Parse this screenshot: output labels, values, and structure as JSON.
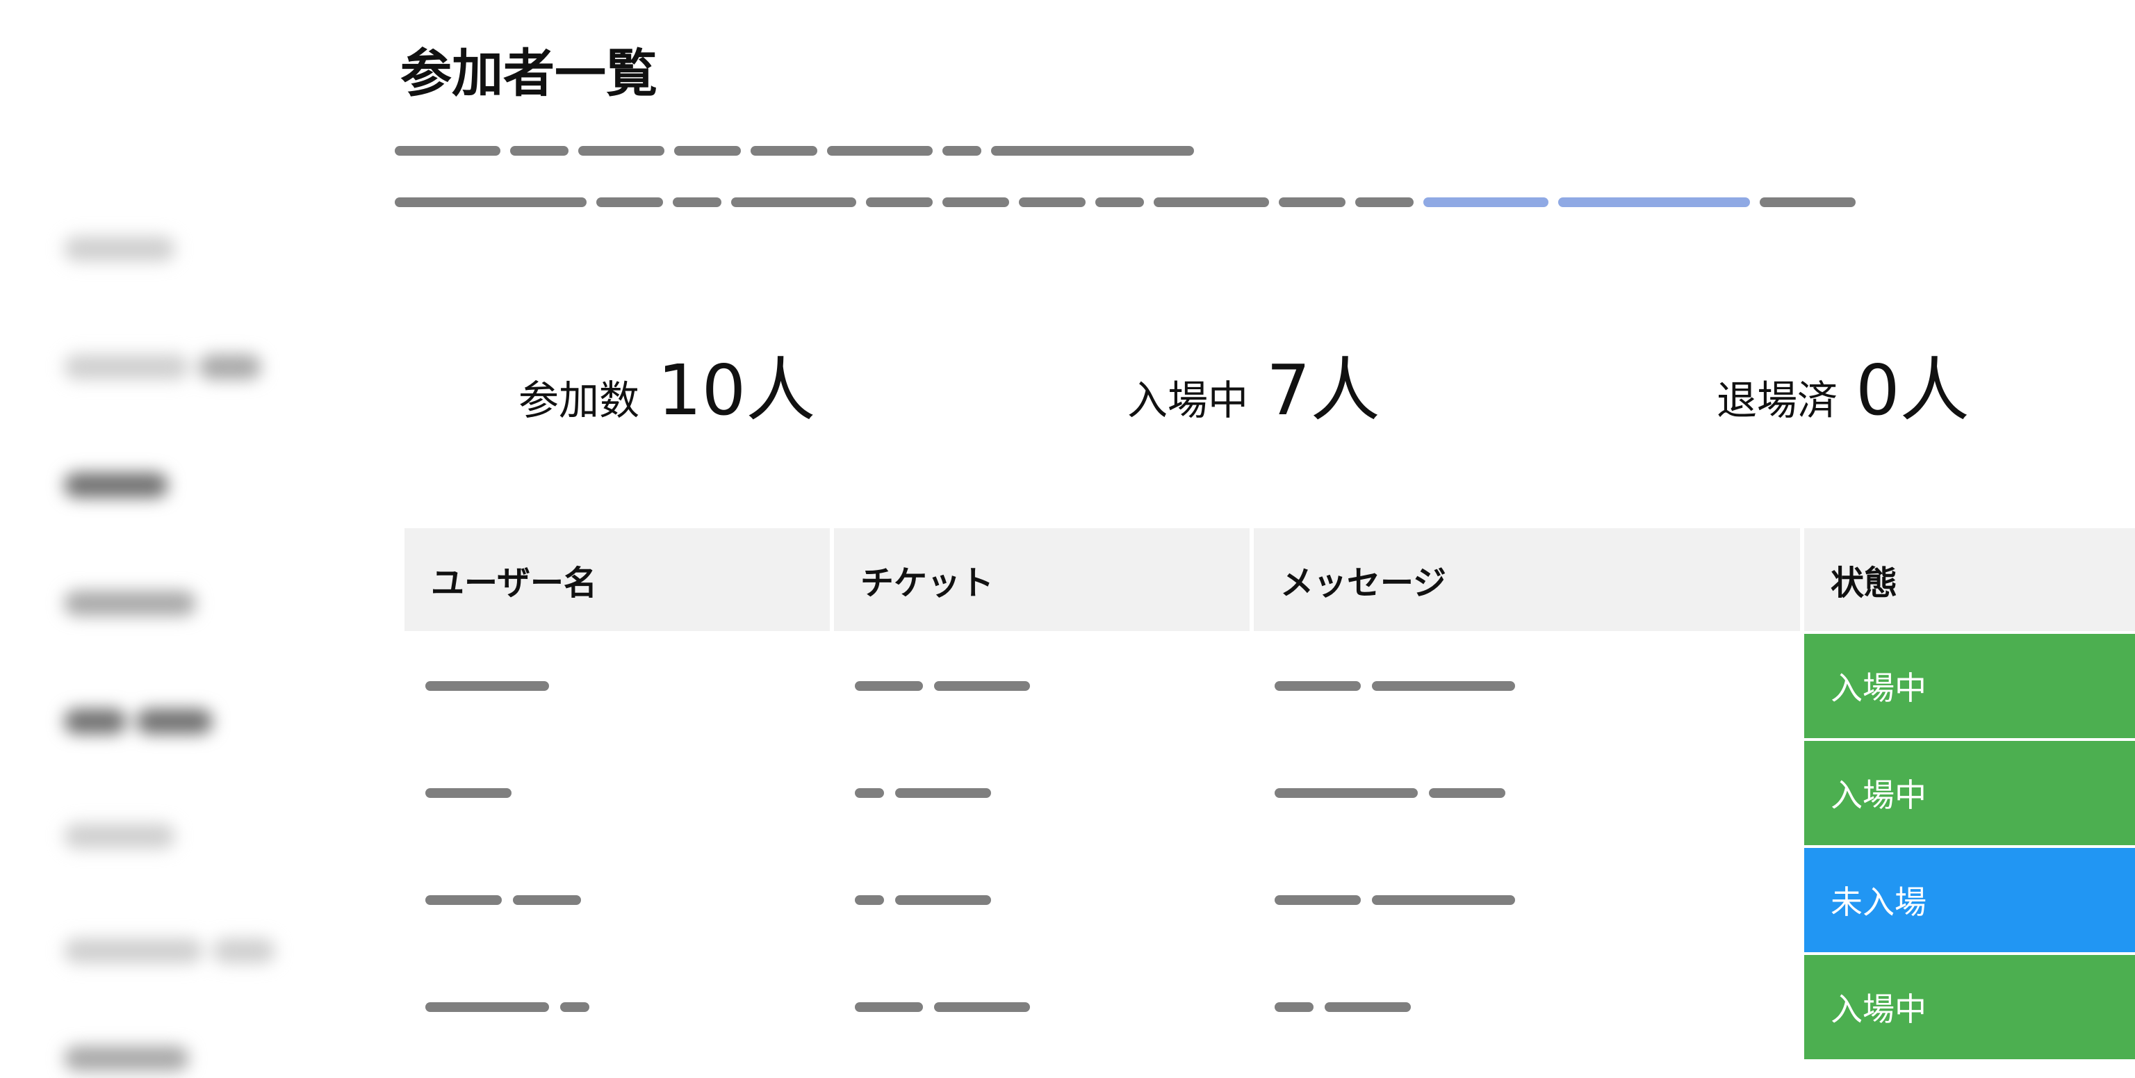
{
  "page": {
    "title": "参加者一覧"
  },
  "stats": [
    {
      "label": "参加数",
      "value": "10人"
    },
    {
      "label": "入場中",
      "value": "7人"
    },
    {
      "label": "退場済",
      "value": "0人"
    }
  ],
  "table": {
    "headers": [
      "ユーザー名",
      "チケット",
      "メッセージ",
      "状態"
    ],
    "rows": [
      {
        "status": "入場中",
        "status_color": "#4caf50"
      },
      {
        "status": "入場中",
        "status_color": "#4caf50"
      },
      {
        "status": "未入場",
        "status_color": "#2196f3"
      },
      {
        "status": "入場中",
        "status_color": "#4caf50"
      }
    ]
  },
  "colors": {
    "entered": "#4caf50",
    "not_entered": "#2196f3",
    "header_bg": "#f1f1f1",
    "redacted_text": "#7f7f7f",
    "redacted_link": "#8fa9e4"
  }
}
